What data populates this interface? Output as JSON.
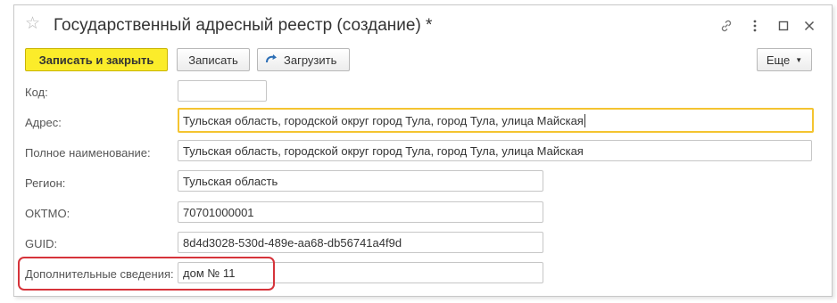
{
  "window": {
    "title": "Государственный адресный реестр (создание) *",
    "controls": {
      "link": "🔗",
      "more": "⋮",
      "maximize": "□",
      "close": "✕"
    }
  },
  "toolbar": {
    "save_close_label": "Записать и закрыть",
    "save_label": "Записать",
    "load_label": "Загрузить",
    "more_label": "Еще"
  },
  "form": {
    "code": {
      "label": "Код:",
      "value": ""
    },
    "address": {
      "label": "Адрес:",
      "value": "Тульская область, городской округ город Тула, город Тула, улица Майская"
    },
    "full_name": {
      "label": "Полное наименование:",
      "value": "Тульская область, городской округ город Тула, город Тула, улица Майская"
    },
    "region": {
      "label": "Регион:",
      "value": "Тульская область"
    },
    "oktmo": {
      "label": "ОКТМО:",
      "value": "70701000001"
    },
    "guid": {
      "label": "GUID:",
      "value": "8d4d3028-530d-489e-aa68-db56741a4f9d"
    },
    "additional": {
      "label": "Дополнительные сведения:",
      "value": "дом № 11"
    }
  },
  "colors": {
    "primary_button": "#fbec2a",
    "focus_border": "#f4c430",
    "highlight": "#d6333a"
  }
}
